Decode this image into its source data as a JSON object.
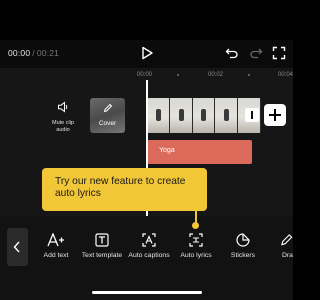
{
  "playbar": {
    "current_time": "00:00",
    "separator": "/",
    "total_time": "00:21"
  },
  "ruler": {
    "ticks": [
      "00:00",
      "00:02",
      "00:04"
    ]
  },
  "timeline": {
    "mute_label": "Mute clip audio",
    "cover_label": "Cover",
    "text_clip": "Yoga"
  },
  "tooltip": {
    "text": "Try our new feature to create auto lyrics"
  },
  "toolbar": {
    "tools": [
      {
        "label": "Add text",
        "icon": "add-text-icon"
      },
      {
        "label": "Text template",
        "icon": "text-template-icon"
      },
      {
        "label": "Auto captions",
        "icon": "auto-captions-icon"
      },
      {
        "label": "Auto lyrics",
        "icon": "auto-lyrics-icon"
      },
      {
        "label": "Stickers",
        "icon": "stickers-icon"
      },
      {
        "label": "Dra",
        "icon": "draw-icon"
      }
    ]
  },
  "colors": {
    "accent": "#f1c737",
    "text_clip": "#dc6a5a"
  }
}
